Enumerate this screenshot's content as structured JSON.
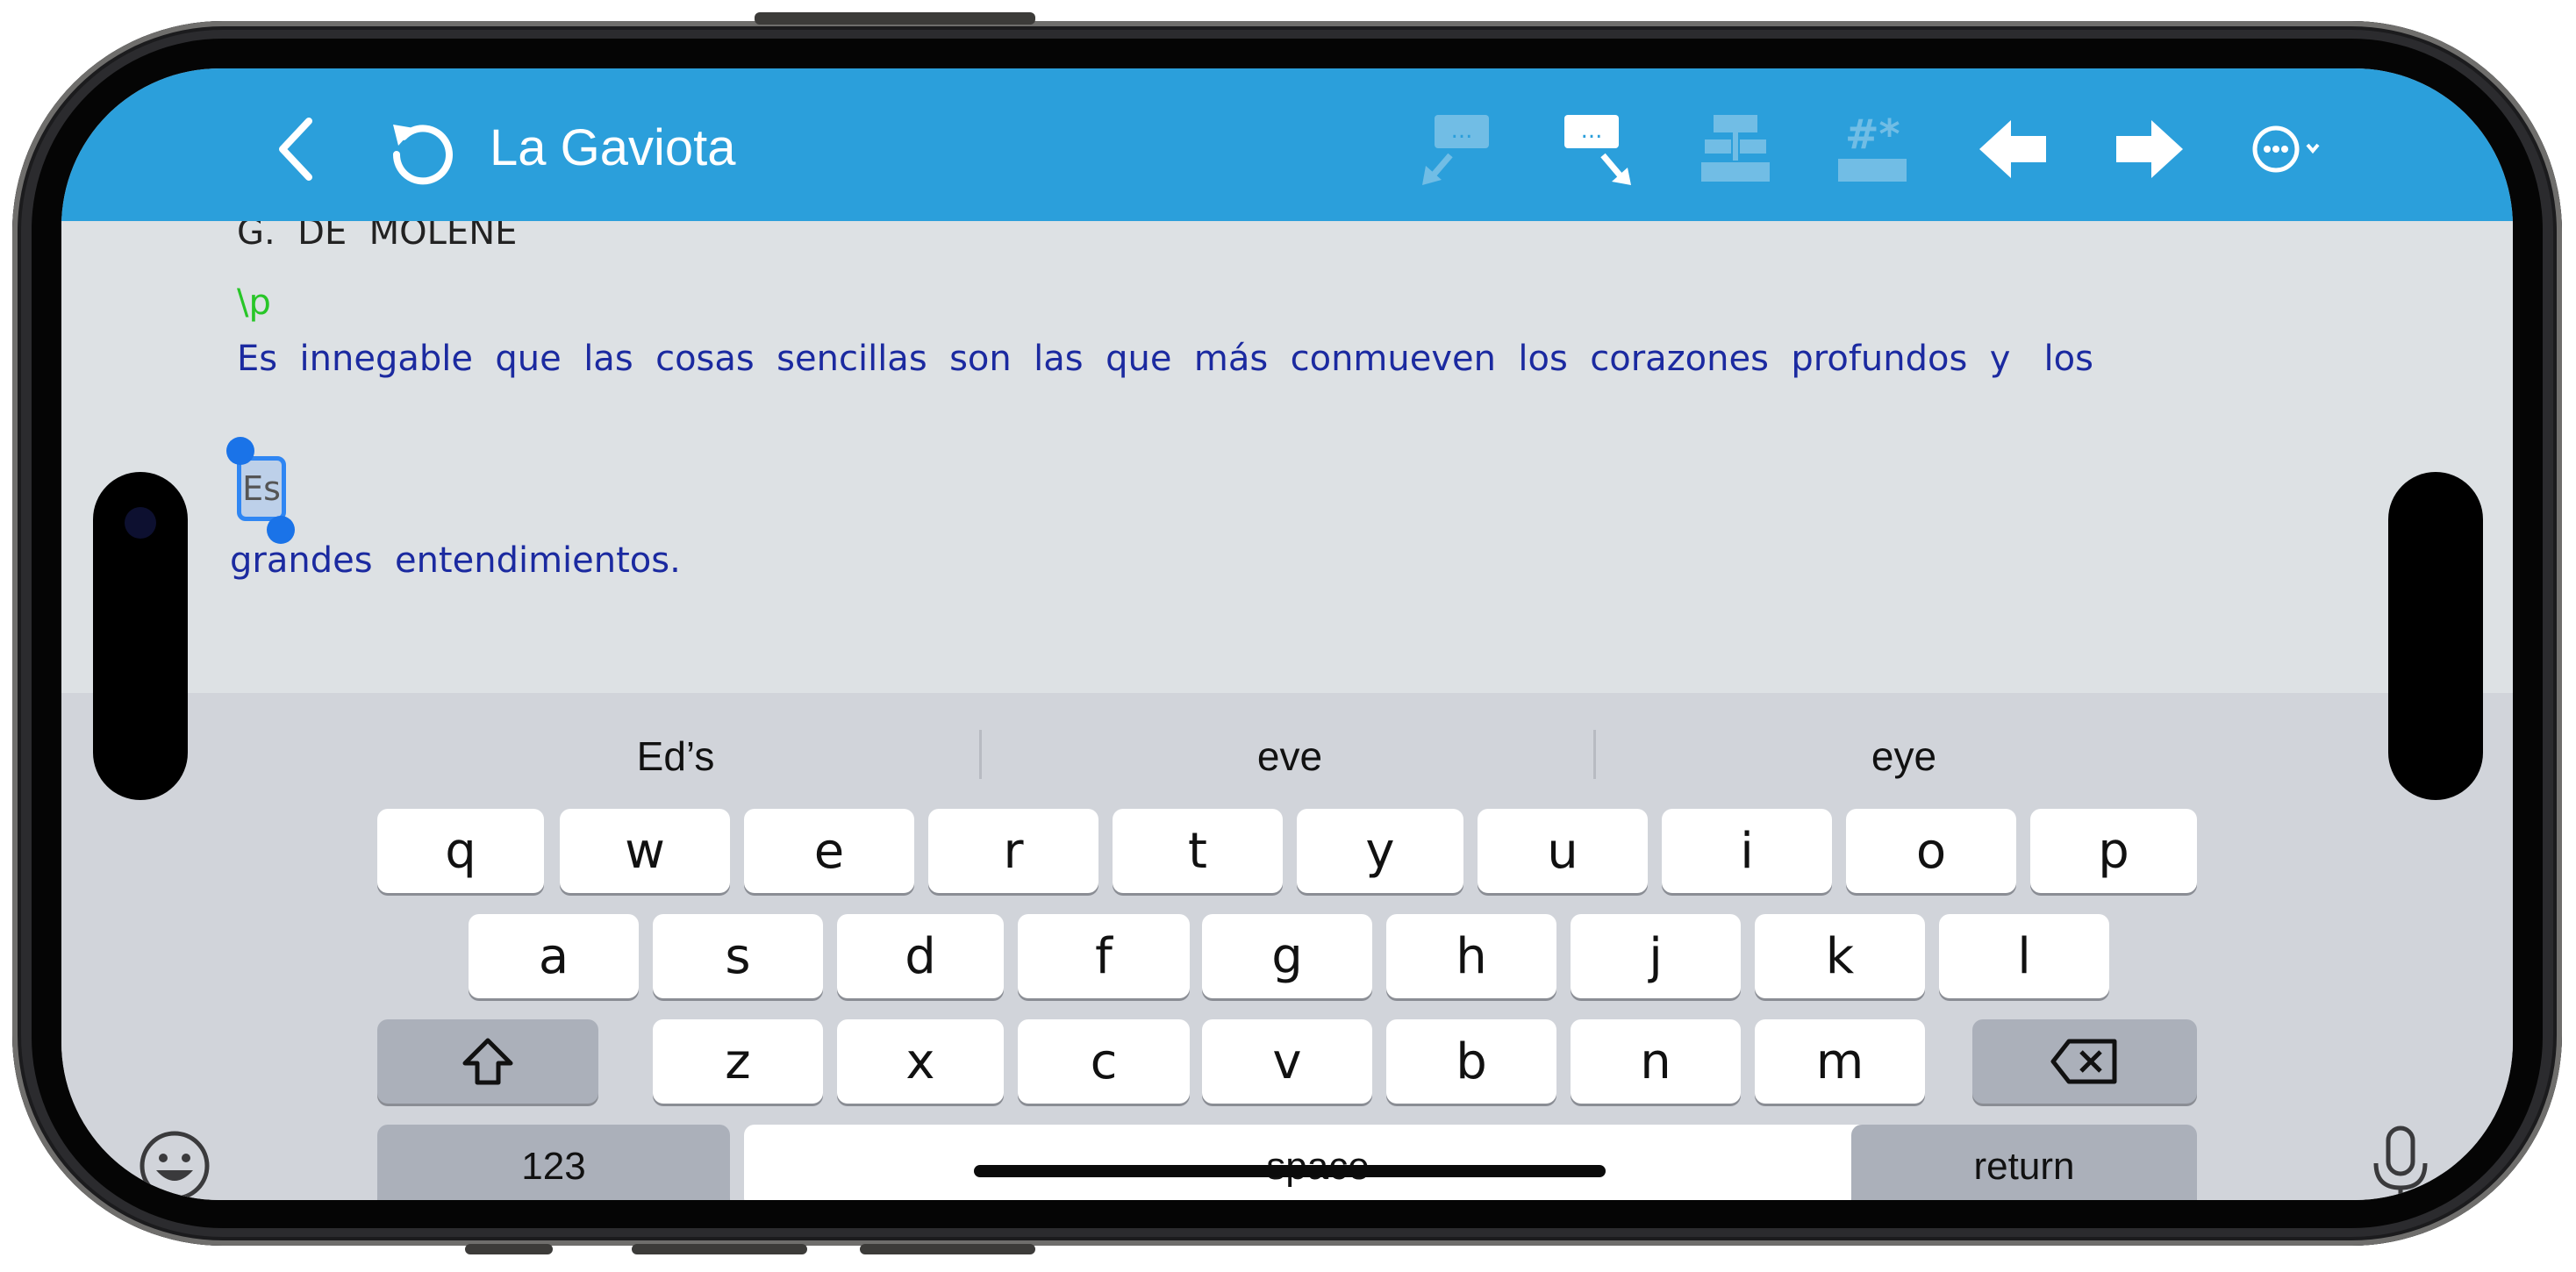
{
  "app": {
    "title": "La Gaviota",
    "toolbar_icons": [
      "back-chevron-icon",
      "undo-rotate-icon",
      "join-up-icon",
      "split-down-icon",
      "merge-icon",
      "hash-marker-icon",
      "arrow-left-icon",
      "arrow-right-icon",
      "more-options-icon"
    ]
  },
  "document": {
    "top_line": "G.  DE  MOLÈNE",
    "marker": "\\p",
    "line1": "Es  innegable  que  las  cosas  sencillas  son  las  que  más  conmueven  los  corazones  profundos  y   los",
    "selected_word": "Es",
    "line2": "grandes  entendimientos."
  },
  "keyboard": {
    "suggestions": [
      "Ed’s",
      "eve",
      "eye"
    ],
    "row1": [
      "q",
      "w",
      "e",
      "r",
      "t",
      "y",
      "u",
      "i",
      "o",
      "p"
    ],
    "row2": [
      "a",
      "s",
      "d",
      "f",
      "g",
      "h",
      "j",
      "k",
      "l"
    ],
    "row3": [
      "z",
      "x",
      "c",
      "v",
      "b",
      "n",
      "m"
    ],
    "numbers_label": "123",
    "space_label": "space",
    "return_label": "return"
  },
  "colors": {
    "toolbar": "#2b9fdb",
    "text": "#1b2aa0",
    "marker": "#28c628",
    "selection": "#2f86f3"
  }
}
